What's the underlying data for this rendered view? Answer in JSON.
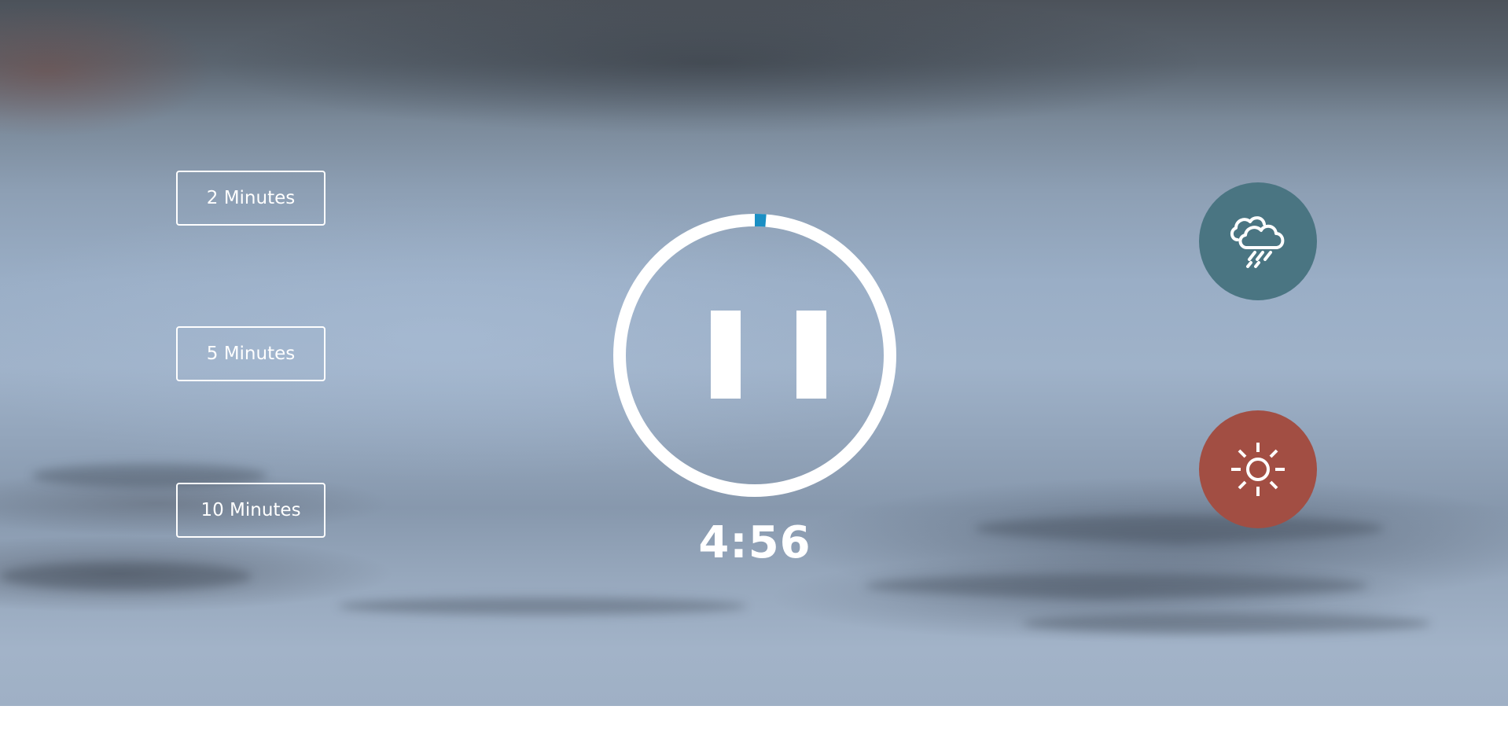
{
  "durations": [
    {
      "label": "2 Minutes"
    },
    {
      "label": "5 Minutes"
    },
    {
      "label": "10 Minutes"
    }
  ],
  "timer": {
    "remaining": "4:56",
    "progress": 0.013,
    "state_icon": "pause-icon",
    "ring_color": "#ffffff",
    "progress_color": "#1a8fc4"
  },
  "scenes": [
    {
      "name": "rain",
      "icon": "rain-cloud-icon",
      "color": "#4a7582"
    },
    {
      "name": "sun",
      "icon": "sun-icon",
      "color": "#a24e43"
    }
  ]
}
